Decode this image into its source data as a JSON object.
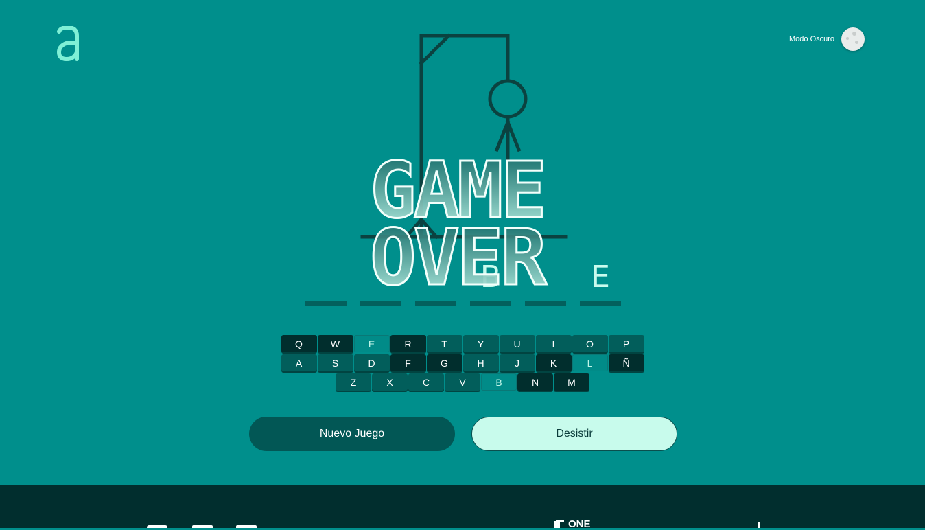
{
  "header": {
    "logo_letter": "a",
    "dark_mode_label": "Modo Oscuro"
  },
  "word": {
    "letters": [
      "",
      "",
      "",
      "B",
      "",
      "E"
    ]
  },
  "game_over": {
    "line1": "GAME",
    "line2": "OVER"
  },
  "keyboard": {
    "rows": [
      [
        {
          "k": "Q",
          "s": "played"
        },
        {
          "k": "W",
          "s": "played"
        },
        {
          "k": "E",
          "s": "right"
        },
        {
          "k": "R",
          "s": "played"
        },
        {
          "k": "T",
          "s": ""
        },
        {
          "k": "Y",
          "s": ""
        },
        {
          "k": "U",
          "s": ""
        },
        {
          "k": "I",
          "s": ""
        },
        {
          "k": "O",
          "s": ""
        },
        {
          "k": "P",
          "s": ""
        }
      ],
      [
        {
          "k": "A",
          "s": ""
        },
        {
          "k": "S",
          "s": ""
        },
        {
          "k": "D",
          "s": ""
        },
        {
          "k": "F",
          "s": "played"
        },
        {
          "k": "G",
          "s": "played"
        },
        {
          "k": "H",
          "s": ""
        },
        {
          "k": "J",
          "s": ""
        },
        {
          "k": "K",
          "s": "played"
        },
        {
          "k": "L",
          "s": "right"
        },
        {
          "k": "Ñ",
          "s": "played"
        }
      ],
      [
        {
          "k": "Z",
          "s": ""
        },
        {
          "k": "X",
          "s": ""
        },
        {
          "k": "C",
          "s": ""
        },
        {
          "k": "V",
          "s": ""
        },
        {
          "k": "B",
          "s": "right"
        },
        {
          "k": "N",
          "s": "played"
        },
        {
          "k": "M",
          "s": "played"
        }
      ]
    ]
  },
  "buttons": {
    "new_game": "Nuevo Juego",
    "give_up": "Desistir"
  },
  "footer": {
    "brand_text": "ONE"
  },
  "colors": {
    "background": "#008f8c",
    "key_default": "#025e5b",
    "key_played": "#012e2d",
    "key_correct": "#018b88",
    "accent_mint": "#c8fbec",
    "footer": "#012e2e"
  }
}
